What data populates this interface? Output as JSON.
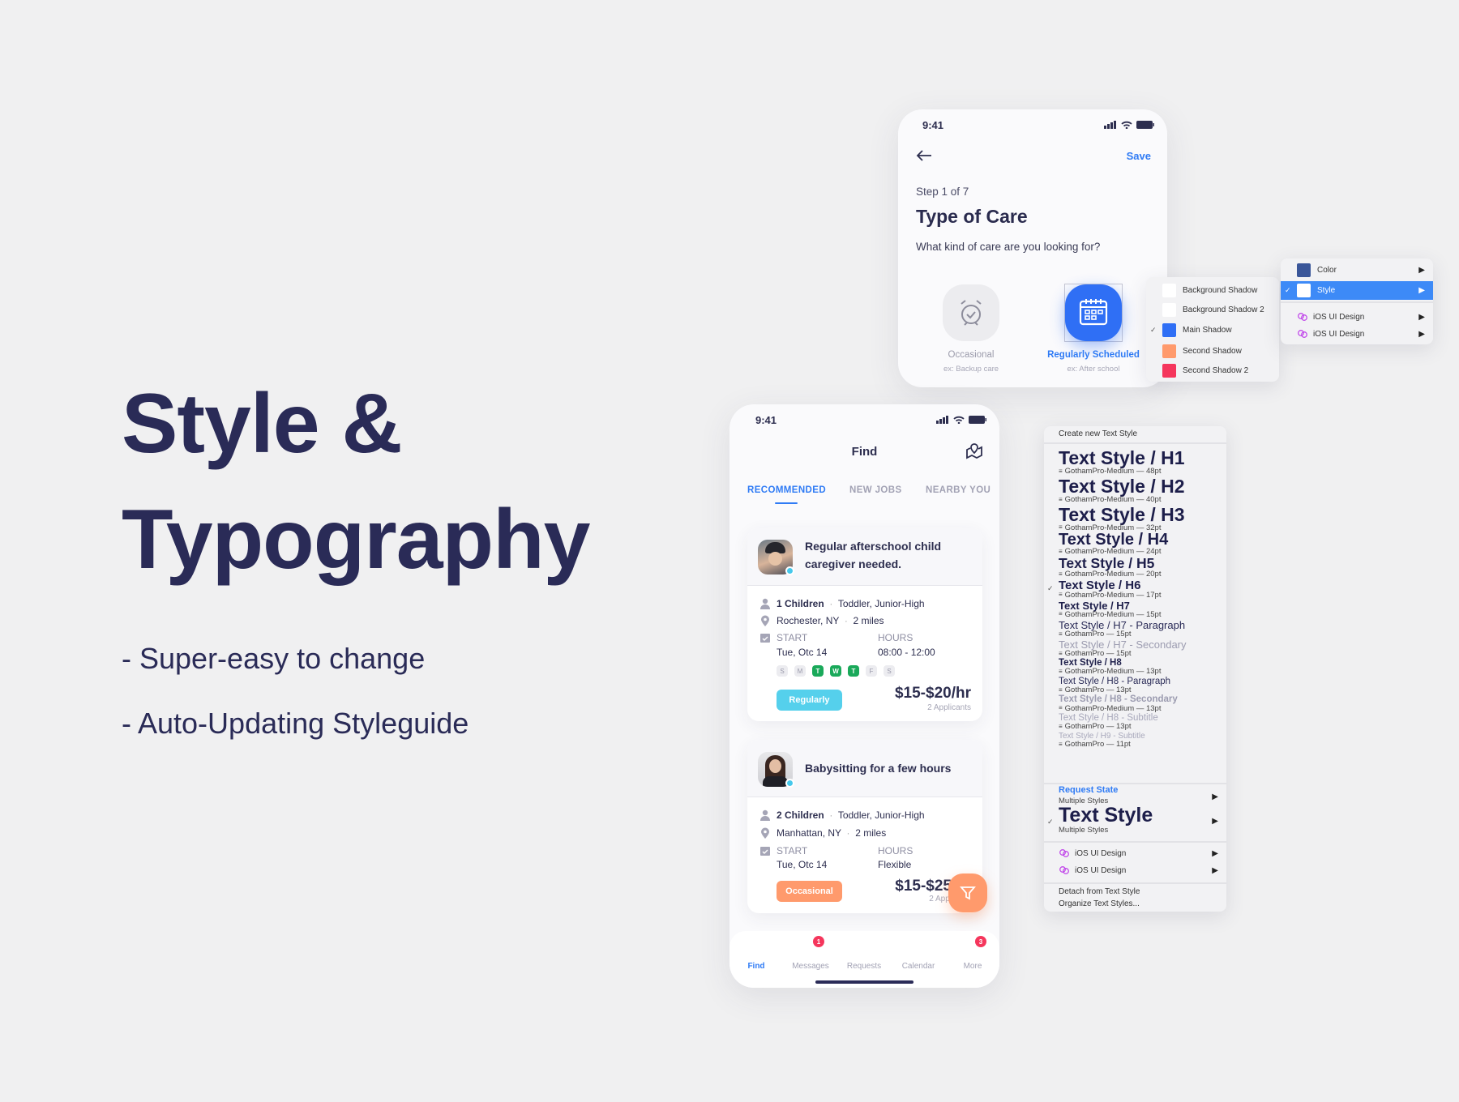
{
  "hero": {
    "line1": "Style &",
    "line2": "Typography",
    "bullets": [
      "- Super-easy to change",
      "- Auto-Updating Styleguide"
    ]
  },
  "colors": {
    "navy": "#2a2b57",
    "blue": "#2f7bf5",
    "cyan": "#55d0ec",
    "orange": "#ff9a6c",
    "green": "#1aa95a",
    "red": "#f5365c"
  },
  "care_screen": {
    "time": "9:41",
    "save": "Save",
    "step": "Step 1 of 7",
    "title": "Type of Care",
    "question": "What kind of care are you looking for?",
    "options": [
      {
        "label": "Occasional",
        "sub": "ex: Backup care",
        "icon": "alarm-clock-icon",
        "selected": false
      },
      {
        "label": "Regularly Scheduled",
        "sub": "ex: After school",
        "icon": "calendar-icon",
        "selected": true
      }
    ]
  },
  "shadow_menu": {
    "items": [
      {
        "label": "Background Shadow",
        "color": "#ffffff",
        "checked": false
      },
      {
        "label": "Background Shadow 2",
        "color": "#ffffff",
        "checked": false
      },
      {
        "label": "Main Shadow",
        "color": "#2f6ff5",
        "checked": true
      },
      {
        "label": "Second Shadow",
        "color": "#ff9a6c",
        "checked": false
      },
      {
        "label": "Second Shadow 2",
        "color": "#f5365c",
        "checked": false
      }
    ]
  },
  "style_menu": {
    "items": [
      {
        "label": "Color",
        "color": "#3a5699",
        "selected": false
      },
      {
        "label": "Style",
        "color": "#ffffff",
        "selected": true
      }
    ],
    "libraries": [
      "iOS UI Design",
      "iOS UI Design"
    ]
  },
  "find_screen": {
    "time": "9:41",
    "title": "Find",
    "tabs": [
      {
        "label": "RECOMMENDED",
        "active": true
      },
      {
        "label": "NEW JOBS",
        "active": false
      },
      {
        "label": "NEARBY YOU",
        "active": false
      }
    ],
    "start_label": "START",
    "hours_label": "HOURS",
    "jobs": [
      {
        "title_1": "Regular afterschool child",
        "title_2": "caregiver needed.",
        "children": "1 Children",
        "ages": "Toddler, Junior-High",
        "location": "Rochester, NY",
        "distance": "2 miles",
        "start": "Tue, Otc 14",
        "hours": "08:00 - 12:00",
        "days": [
          [
            "S",
            false
          ],
          [
            "M",
            false
          ],
          [
            "T",
            true
          ],
          [
            "W",
            true
          ],
          [
            "T",
            true
          ],
          [
            "F",
            false
          ],
          [
            "S",
            false
          ]
        ],
        "type": "Regularly",
        "price": "$15-$20/hr",
        "applicants": "2 Applicants"
      },
      {
        "title_1": "Babysitting for a few hours",
        "title_2": "",
        "children": "2 Children",
        "ages": "Toddler, Junior-High",
        "location": "Manhattan, NY",
        "distance": "2 miles",
        "start": "Tue, Otc 14",
        "hours": "Flexible",
        "type": "Occasional",
        "price": "$15-$25",
        "applicants": "2 Appl"
      }
    ],
    "nav": [
      {
        "label": "Find",
        "icon": "search-icon",
        "active": true,
        "badge": ""
      },
      {
        "label": "Messages",
        "icon": "chat-icon",
        "active": false,
        "badge": "1"
      },
      {
        "label": "Requests",
        "icon": "requests-icon",
        "active": false,
        "badge": ""
      },
      {
        "label": "Calendar",
        "icon": "calendar-icon",
        "active": false,
        "badge": ""
      },
      {
        "label": "More",
        "icon": "menu-icon",
        "active": false,
        "badge": "3"
      }
    ]
  },
  "text_style_menu": {
    "create": "Create new Text Style",
    "styles": [
      {
        "name": "Text Style / H1",
        "spec": "GothamPro-Medium — 48pt"
      },
      {
        "name": "Text Style / H2",
        "spec": "GothamPro-Medium — 40pt"
      },
      {
        "name": "Text Style / H3",
        "spec": "GothamPro-Medium — 32pt"
      },
      {
        "name": "Text Style / H4",
        "spec": "GothamPro-Medium — 24pt"
      },
      {
        "name": "Text Style / H5",
        "spec": "GothamPro-Medium — 20pt"
      },
      {
        "name": "Text Style / H6",
        "spec": "GothamPro-Medium — 17pt",
        "checked": true
      },
      {
        "name": "Text Style / H7",
        "spec": "GothamPro-Medium — 15pt"
      },
      {
        "name": "Text Style / H7 - Paragraph",
        "spec": "GothamPro — 15pt"
      },
      {
        "name": "Text Style / H7 - Secondary",
        "spec": "GothamPro — 15pt"
      },
      {
        "name": "Text Style / H8",
        "spec": "GothamPro-Medium — 13pt"
      },
      {
        "name": "Text Style / H8 - Paragraph",
        "spec": "GothamPro — 13pt"
      },
      {
        "name": "Text Style / H8 - Secondary",
        "spec": "GothamPro-Medium — 13pt"
      },
      {
        "name": "Text Style / H8 - Subtitle",
        "spec": "GothamPro — 13pt"
      },
      {
        "name": "Text Style / H9 - Subtitle",
        "spec": "GothamPro — 11pt"
      }
    ],
    "request_state": "Request State",
    "multiple_1": "Multiple Styles",
    "current": "Text Style",
    "multiple_2": "Multiple Styles",
    "libraries": [
      "iOS UI Design",
      "iOS UI Design"
    ],
    "detach": "Detach from Text Style",
    "organize": "Organize Text Styles..."
  }
}
